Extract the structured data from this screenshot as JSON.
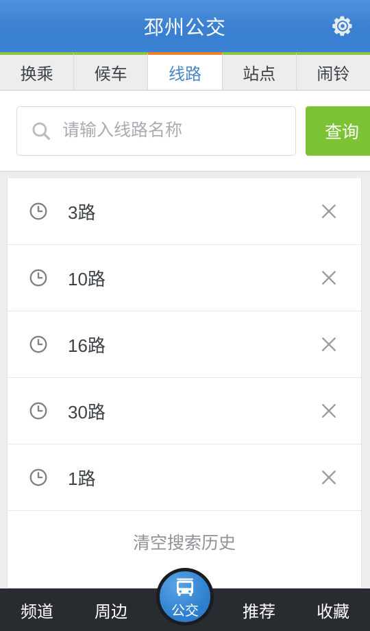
{
  "header": {
    "title": "邳州公交",
    "settings_icon": "gear-icon",
    "background_color": "#3a7fd0",
    "title_color": "#ffffff"
  },
  "tabs": {
    "active_index": 2,
    "active_accent_color": "#ef7f28",
    "inactive_accent_color": "#8cc63e",
    "active_text_color": "#4a87c8",
    "items": [
      {
        "label": "换乘"
      },
      {
        "label": "候车"
      },
      {
        "label": "线路"
      },
      {
        "label": "站点"
      },
      {
        "label": "闹铃"
      }
    ]
  },
  "search": {
    "icon": "search-icon",
    "placeholder": "请输入线路名称",
    "value": "",
    "button_label": "查询",
    "button_color": "#7cc235"
  },
  "history": {
    "row_icon": "clock-icon",
    "delete_icon": "close-icon",
    "items": [
      {
        "label": "3路"
      },
      {
        "label": "10路"
      },
      {
        "label": "16路"
      },
      {
        "label": "30路"
      },
      {
        "label": "1路"
      }
    ],
    "clear_label": "清空搜索历史",
    "clear_text_color": "#8f9397"
  },
  "bottom_nav": {
    "background_color": "#282c31",
    "center_color": "#2f81cf",
    "items": [
      {
        "label": "频道"
      },
      {
        "label": "周边"
      },
      {
        "label": "公交",
        "icon": "bus-icon",
        "active": true
      },
      {
        "label": "推荐"
      },
      {
        "label": "收藏"
      }
    ]
  }
}
